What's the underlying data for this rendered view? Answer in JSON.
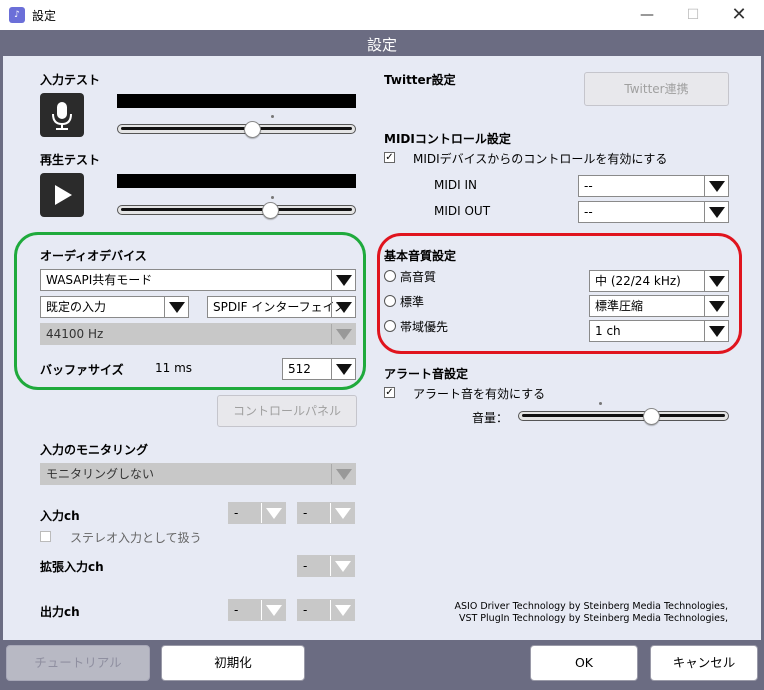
{
  "window": {
    "title": "設定",
    "app_icon": "app-icon"
  },
  "header": {
    "title": "設定"
  },
  "input_test": {
    "label": "入力テスト",
    "icon": "microphone-icon",
    "level": 0.65
  },
  "playback_test": {
    "label": "再生テスト",
    "icon": "play-icon",
    "level": 0.7
  },
  "audio_device": {
    "label": "オーディオデバイス",
    "driver": "WASAPI共有モード",
    "input": "既定の入力",
    "output": "SPDIF インターフェイス",
    "sample_rate": "44100 Hz",
    "buffer_label": "バッファサイズ",
    "buffer_ms": "11 ms",
    "buffer_value": "512",
    "control_panel_button": "コントロールパネル"
  },
  "monitoring": {
    "label": "入力のモニタリング",
    "value": "モニタリングしない"
  },
  "input_ch": {
    "label": "入力ch",
    "left": "-",
    "right": "-",
    "stereo_label": "ステレオ入力として扱う",
    "stereo_checked": false
  },
  "extended_input_ch": {
    "label": "拡張入力ch",
    "value": "-"
  },
  "output_ch": {
    "label": "出力ch",
    "left": "-",
    "right": "-"
  },
  "twitter": {
    "label": "Twitter設定",
    "button": "Twitter連携"
  },
  "midi": {
    "label": "MIDIコントロール設定",
    "enable_label": "MIDIデバイスからのコントロールを有効にする",
    "enable_checked": true,
    "in_label": "MIDI IN",
    "in_value": "--",
    "out_label": "MIDI OUT",
    "out_value": "--"
  },
  "quality": {
    "label": "基本音質設定",
    "options": [
      {
        "label": "高音質",
        "value": "中 (22/24 kHz)"
      },
      {
        "label": "標準",
        "value": "標準圧縮"
      },
      {
        "label": "帯域優先",
        "value": "1 ch"
      }
    ]
  },
  "alert": {
    "label": "アラート音設定",
    "enable_label": "アラート音を有効にする",
    "enable_checked": true,
    "volume_label": "音量：",
    "volume_level": 0.6
  },
  "credits": {
    "line1": "ASIO Driver Technology by Steinberg Media Technologies,",
    "line2": "VST PlugIn Technology by Steinberg Media Technologies,"
  },
  "footer": {
    "tutorial": "チュートリアル",
    "reset": "初期化",
    "ok": "OK",
    "cancel": "キャンセル"
  },
  "colors": {
    "band": "#6b6c82",
    "panel": "#e7eaf4",
    "highlight_green": "#1faa3c",
    "highlight_red": "#e0141e"
  }
}
